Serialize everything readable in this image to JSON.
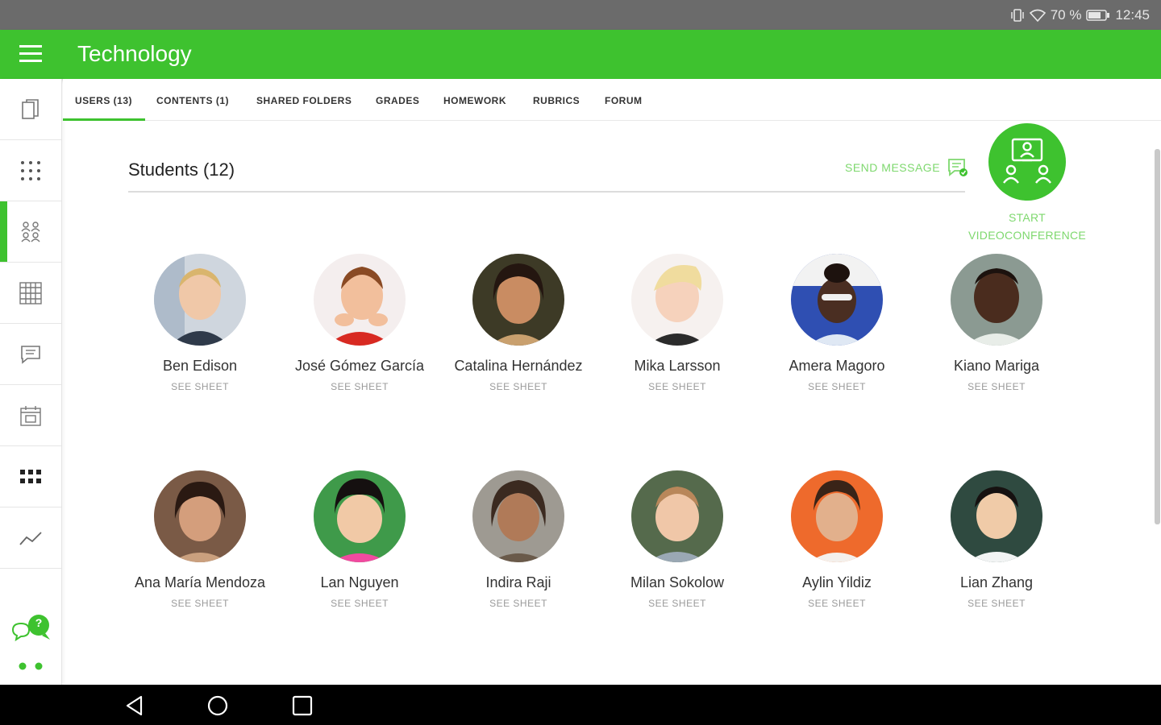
{
  "status_bar": {
    "battery": "70 %",
    "time": "12:45"
  },
  "app": {
    "title": "Technology"
  },
  "tabs": [
    {
      "label": "USERS (13)"
    },
    {
      "label": "CONTENTS (1)"
    },
    {
      "label": "SHARED FOLDERS"
    },
    {
      "label": "GRADES"
    },
    {
      "label": "HOMEWORK"
    },
    {
      "label": "RUBRICS"
    },
    {
      "label": "FORUM"
    }
  ],
  "section": {
    "title": "Students (12)",
    "send_message": "SEND MESSAGE"
  },
  "videoconference": {
    "label_line1": "START",
    "label_line2": "VIDEOCONFERENCE"
  },
  "students": [
    {
      "name": "Ben Edison",
      "action": "SEE SHEET"
    },
    {
      "name": "José Gómez García",
      "action": "SEE SHEET"
    },
    {
      "name": "Catalina Hernández",
      "action": "SEE SHEET"
    },
    {
      "name": "Mika Larsson",
      "action": "SEE SHEET"
    },
    {
      "name": "Amera Magoro",
      "action": "SEE SHEET"
    },
    {
      "name": "Kiano Mariga",
      "action": "SEE SHEET"
    },
    {
      "name": "Ana María Mendoza",
      "action": "SEE SHEET"
    },
    {
      "name": "Lan Nguyen",
      "action": "SEE SHEET"
    },
    {
      "name": "Indira Raji",
      "action": "SEE SHEET"
    },
    {
      "name": "Milan Sokolow",
      "action": "SEE SHEET"
    },
    {
      "name": "Aylin Yildiz",
      "action": "SEE SHEET"
    },
    {
      "name": "Lian Zhang",
      "action": "SEE SHEET"
    }
  ],
  "chat_badge": "?",
  "colors": {
    "accent": "#3ec22f",
    "accent_light": "#7ed86e",
    "status_bar": "#6b6b6b"
  }
}
